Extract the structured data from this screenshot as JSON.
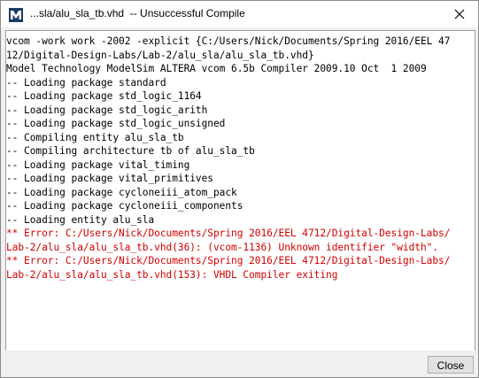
{
  "window": {
    "title": "...sla/alu_sla_tb.vhd  -- Unsuccessful Compile"
  },
  "colors": {
    "normal_text": "#000000",
    "error_text": "#d40000"
  },
  "console": {
    "lines": [
      {
        "text": "vcom -work work -2002 -explicit {C:/Users/Nick/Documents/Spring 2016/EEL 47",
        "type": "normal"
      },
      {
        "text": "12/Digital-Design-Labs/Lab-2/alu_sla/alu_sla_tb.vhd}",
        "type": "normal"
      },
      {
        "text": "Model Technology ModelSim ALTERA vcom 6.5b Compiler 2009.10 Oct  1 2009",
        "type": "normal"
      },
      {
        "text": "-- Loading package standard",
        "type": "normal"
      },
      {
        "text": "-- Loading package std_logic_1164",
        "type": "normal"
      },
      {
        "text": "-- Loading package std_logic_arith",
        "type": "normal"
      },
      {
        "text": "-- Loading package std_logic_unsigned",
        "type": "normal"
      },
      {
        "text": "-- Compiling entity alu_sla_tb",
        "type": "normal"
      },
      {
        "text": "-- Compiling architecture tb of alu_sla_tb",
        "type": "normal"
      },
      {
        "text": "-- Loading package vital_timing",
        "type": "normal"
      },
      {
        "text": "-- Loading package vital_primitives",
        "type": "normal"
      },
      {
        "text": "-- Loading package cycloneiii_atom_pack",
        "type": "normal"
      },
      {
        "text": "-- Loading package cycloneiii_components",
        "type": "normal"
      },
      {
        "text": "-- Loading entity alu_sla",
        "type": "normal"
      },
      {
        "text": "** Error: C:/Users/Nick/Documents/Spring 2016/EEL 4712/Digital-Design-Labs/",
        "type": "error"
      },
      {
        "text": "Lab-2/alu_sla/alu_sla_tb.vhd(36): (vcom-1136) Unknown identifier \"width\".",
        "type": "error"
      },
      {
        "text": "** Error: C:/Users/Nick/Documents/Spring 2016/EEL 4712/Digital-Design-Labs/",
        "type": "error"
      },
      {
        "text": "Lab-2/alu_sla/alu_sla_tb.vhd(153): VHDL Compiler exiting",
        "type": "error"
      }
    ]
  },
  "footer": {
    "close_label": "Close"
  },
  "icons": {
    "app": "modelsim-logo-icon",
    "titlebar_close": "close-icon"
  }
}
